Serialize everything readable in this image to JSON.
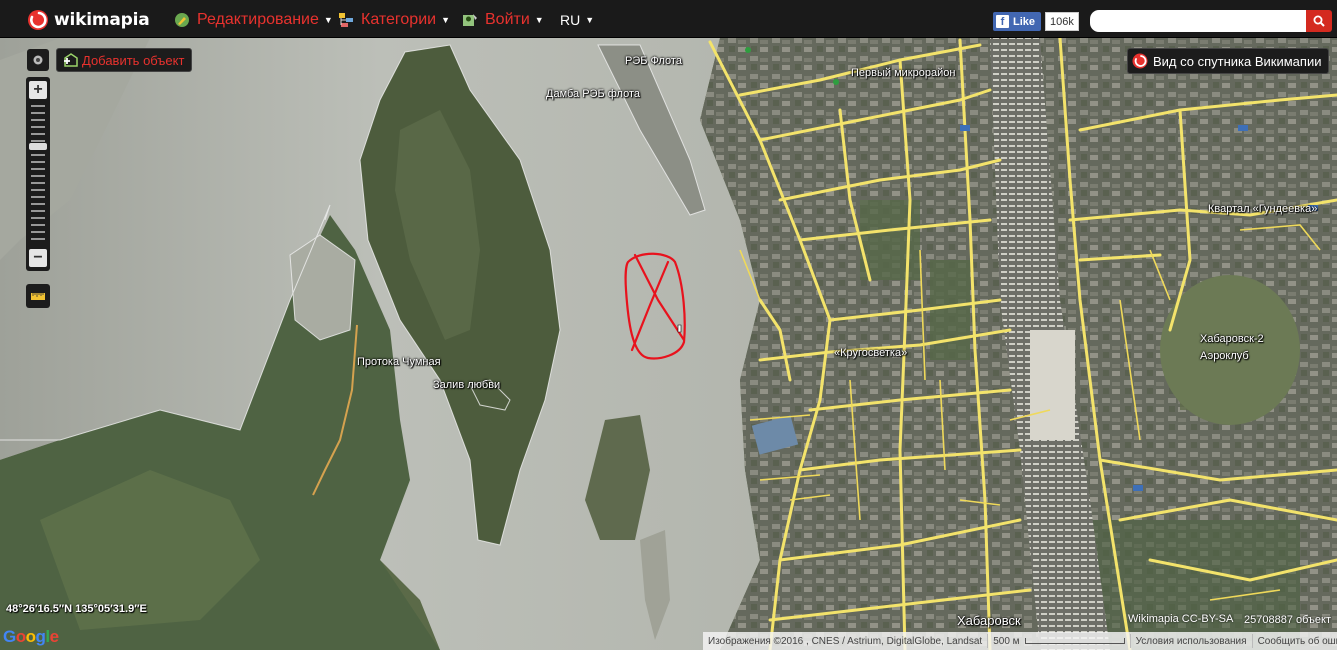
{
  "app": {
    "logo_text": "wikimapia"
  },
  "nav": {
    "items": [
      {
        "label": "Редактирование",
        "icon": "edit-icon"
      },
      {
        "label": "Категории",
        "icon": "categories-icon"
      },
      {
        "label": "Войти",
        "icon": "user-icon"
      }
    ],
    "language": "RU"
  },
  "facebook": {
    "like_label": "Like",
    "f_letter": "f",
    "count": "106k"
  },
  "search": {
    "value": "",
    "placeholder": ""
  },
  "controls": {
    "add_object_label": "Добавить объект",
    "satellite_view_label": "Вид со спутника Викимапии",
    "zoom_in": "+",
    "zoom_out": "−"
  },
  "map_labels": {
    "reb_flota": "РЭБ Флота",
    "damba": "Дамба РЭБ флота",
    "first_microdistrict": "Первый микрорайон",
    "kvartal": "Квартал «Гундеевка»",
    "protoka": "Протока Чумная",
    "zaliv": "Залив любви",
    "krugosvetka": "«Кругосветка»",
    "aeroklub_1": "Хабаровск-2",
    "aeroklub_2": "Аэроклуб",
    "city": "Хабаровск"
  },
  "status": {
    "coordinates": "48°26′16.5″N 135°05′31.9″E",
    "google_logo": "Google",
    "license": "Wikimapia CC-BY-SA",
    "object_count": "25708887 объект",
    "imagery": "Изображения ©2016 , CNES / Astrium, DigitalGlobe, Landsat",
    "scale": "500 м",
    "terms": "Условия использования",
    "report": "Сообщить об ошибке на к"
  },
  "colors": {
    "accent": "#e8322e",
    "topbar_bg": "#1a1a1a",
    "road": "#f3e36b",
    "river": "#b9bcb4",
    "forest": "#4e5e3f"
  }
}
